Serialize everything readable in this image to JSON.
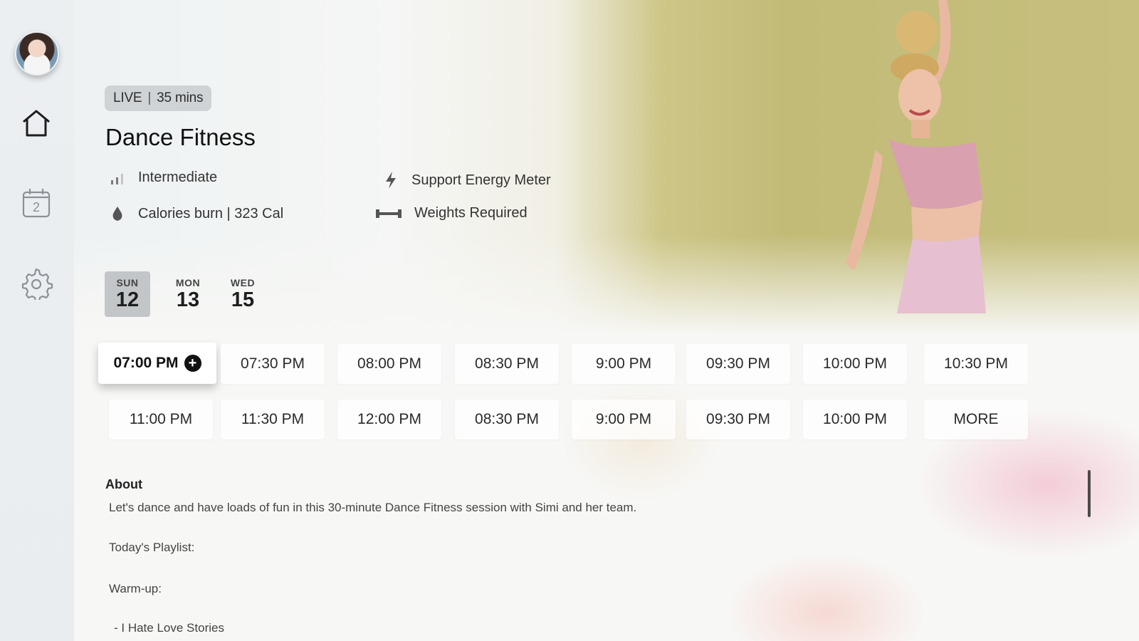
{
  "sidebar": {
    "items": [
      {
        "name": "home",
        "icon": "home-icon"
      },
      {
        "name": "calendar",
        "icon": "calendar-icon",
        "badge": "2"
      },
      {
        "name": "settings",
        "icon": "gear-icon"
      }
    ]
  },
  "class": {
    "badge_live": "LIVE",
    "badge_duration": "35 mins",
    "title": "Dance Fitness",
    "level": "Intermediate",
    "calories": "Calories burn | 323 Cal",
    "energy": "Support Energy Meter",
    "weights": "Weights Required"
  },
  "days": [
    {
      "dow": "SUN",
      "num": "12",
      "selected": true
    },
    {
      "dow": "MON",
      "num": "13"
    },
    {
      "dow": "WED",
      "num": "15"
    }
  ],
  "slots_row1": [
    "07:00 PM",
    "07:30 PM",
    "08:00 PM",
    "08:30 PM",
    "9:00 PM",
    "09:30 PM",
    "10:00 PM",
    "10:30 PM"
  ],
  "slots_row2": [
    "11:00 PM",
    "11:30 PM",
    "12:00 PM",
    "08:30 PM",
    "9:00 PM",
    "09:30 PM",
    "10:00 PM",
    "MORE"
  ],
  "about": {
    "heading": "About",
    "description": "Let's dance and have loads of fun in this 30-minute Dance Fitness session with Simi and her team.",
    "playlist": "Today's Playlist:",
    "warmup": "Warm-up:",
    "track1": "- I Hate Love Stories"
  },
  "colors": {
    "accent": "#111111",
    "badge_bg": "#cfd3d6",
    "hero_bg": "#c6bf7d"
  }
}
